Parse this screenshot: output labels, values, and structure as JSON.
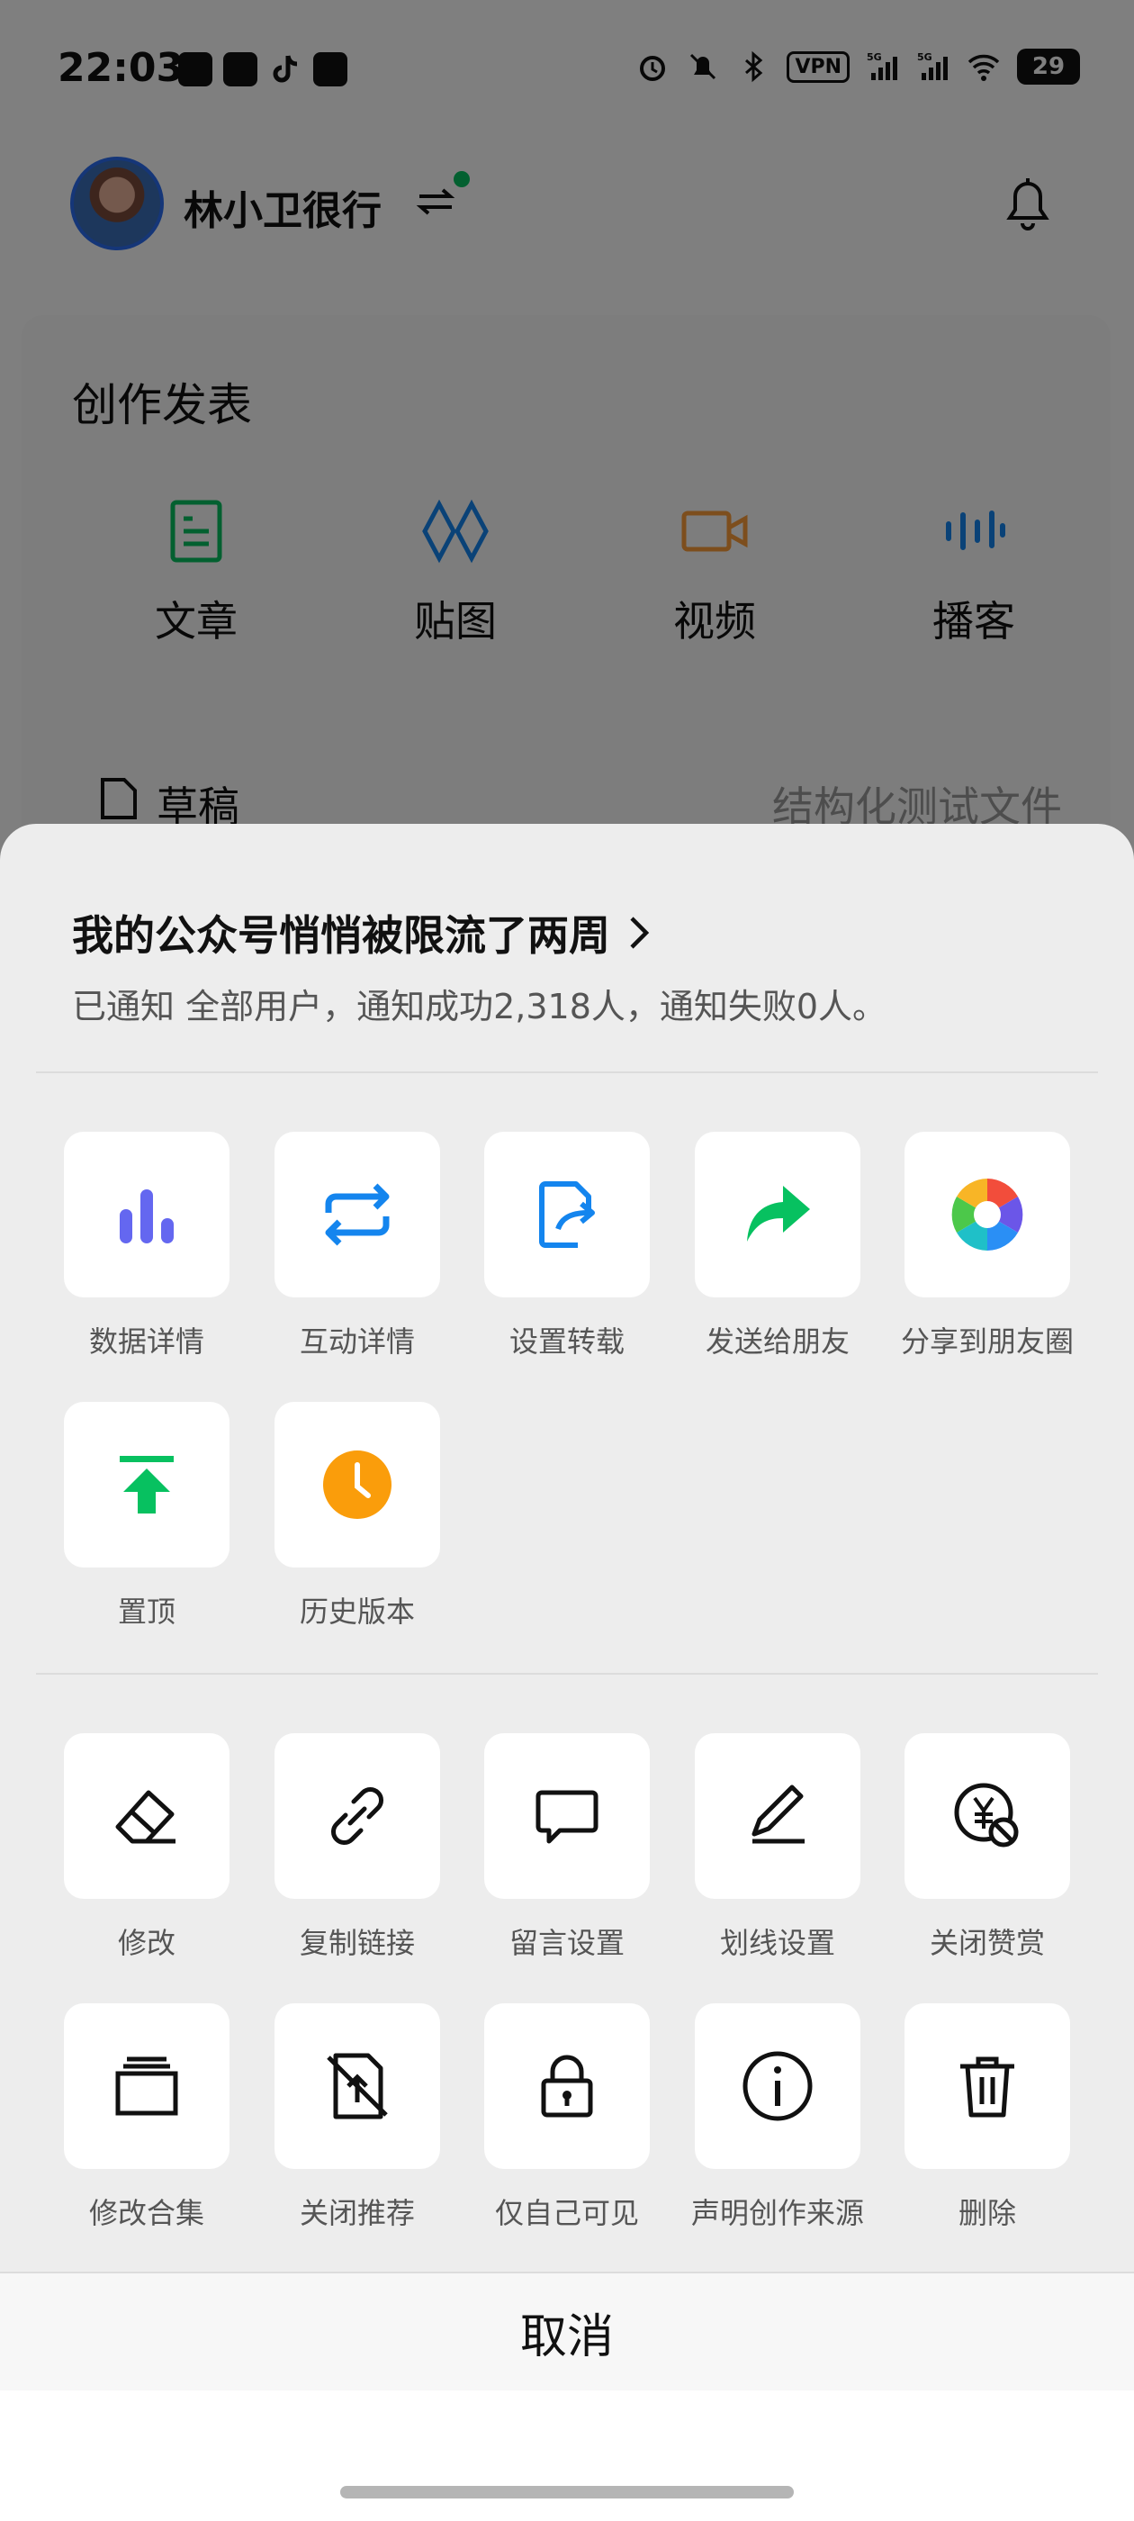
{
  "status_bar": {
    "time": "22:03",
    "vpn": "VPN",
    "battery": "29",
    "network_1": "5G",
    "network_2": "5G"
  },
  "header": {
    "account_name": "林小卫很行"
  },
  "create": {
    "title": "创作发表",
    "items": [
      {
        "label": "文章",
        "icon": "article-icon",
        "color": "#07c160"
      },
      {
        "label": "贴图",
        "icon": "image-post-icon",
        "color": "#1485ee"
      },
      {
        "label": "视频",
        "icon": "video-icon",
        "color": "#fa9d3b"
      },
      {
        "label": "播客",
        "icon": "podcast-icon",
        "color": "#1485ee"
      }
    ],
    "draft_label": "草稿",
    "draft_hint": "结构化测试文件"
  },
  "sheet": {
    "title": "我的公众号悄悄被限流了两周",
    "subtitle": "已通知 全部用户，通知成功2,318人，通知失败0人。",
    "primary_actions": [
      {
        "label": "数据详情",
        "icon": "bar-chart-icon"
      },
      {
        "label": "互动详情",
        "icon": "repeat-arrows-icon"
      },
      {
        "label": "设置转载",
        "icon": "repost-settings-icon"
      },
      {
        "label": "发送给朋友",
        "icon": "share-arrow-icon"
      },
      {
        "label": "分享到朋友圈",
        "icon": "moments-aperture-icon"
      },
      {
        "label": "置顶",
        "icon": "pin-top-icon"
      },
      {
        "label": "历史版本",
        "icon": "history-clock-icon"
      }
    ],
    "secondary_actions": [
      {
        "label": "修改",
        "icon": "eraser-edit-icon"
      },
      {
        "label": "复制链接",
        "icon": "link-icon"
      },
      {
        "label": "留言设置",
        "icon": "comment-bubble-icon"
      },
      {
        "label": "划线设置",
        "icon": "underline-pen-icon"
      },
      {
        "label": "关闭赞赏",
        "icon": "yuan-off-icon"
      },
      {
        "label": "修改合集",
        "icon": "collection-icon"
      },
      {
        "label": "关闭推荐",
        "icon": "recommend-off-icon"
      },
      {
        "label": "仅自己可见",
        "icon": "lock-icon"
      },
      {
        "label": "声明创作来源",
        "icon": "info-icon"
      },
      {
        "label": "删除",
        "icon": "trash-icon"
      }
    ],
    "cancel_label": "取消"
  },
  "colors": {
    "wechat_green": "#07c160",
    "bar_chart": "#6467f0",
    "repeat_blue": "#1485ee",
    "clock_orange": "#fa9d0b"
  }
}
